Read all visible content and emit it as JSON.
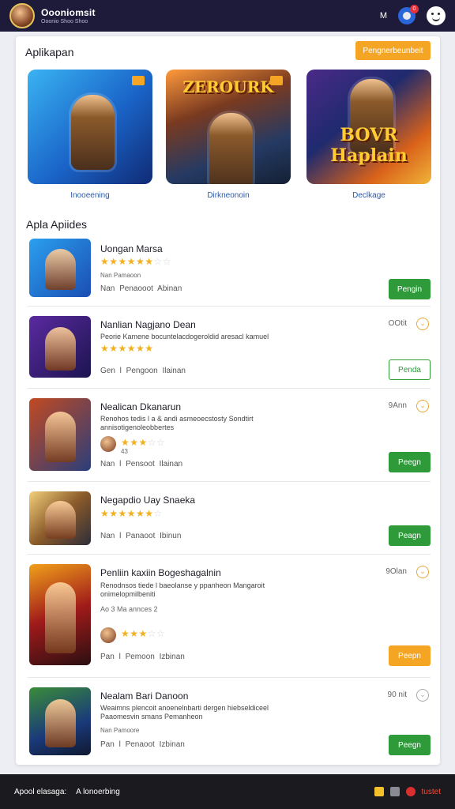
{
  "header": {
    "title": "Oooniomsit",
    "subtitle": "Ooonio Shoo Shoo",
    "right_text": "M",
    "notif_count": "0"
  },
  "featured": {
    "section_title": "Aplikapan",
    "cta_label": "Pengnerbeunbeit",
    "items": [
      {
        "label": "Inooeening",
        "logo": ""
      },
      {
        "label": "Dirkneonoin",
        "logo": "ZEROURK"
      },
      {
        "label": "Declkage",
        "logo": "BOVR Haplain"
      }
    ]
  },
  "list": {
    "section_title": "Apla Apiides",
    "items": [
      {
        "name": "Uongan Marsa",
        "desc": "",
        "rating": 4.5,
        "extra": "Nan Pamaoon",
        "meta": "Nan Penaooot   Abinan",
        "number": "",
        "button": "Pengin",
        "button_style": "green"
      },
      {
        "name": "Nanlian Nagjano Dean",
        "desc": "Peorie Kamene bocuntelacdogeroldid aresacl kamuel",
        "rating": 5,
        "extra": "",
        "meta": "Gen l Pengoon   Ilainan",
        "number": "OOtit",
        "button": "Penda",
        "button_style": "outline"
      },
      {
        "name": "Nealican Dkanarun",
        "desc": "Renohos tedis  l a & andi asmeoecstosty Sondtirt annisotigenoleobbertes",
        "rating": 3,
        "extra": "43",
        "meta": "Nan l Pensoot   Ilainan",
        "number": "9Ann",
        "button": "Peegn",
        "button_style": "green"
      },
      {
        "name": "Negapdio Uay Snaeka",
        "desc": "",
        "rating": 5,
        "extra": "",
        "meta": "Nan l Panaoot   Ibinun",
        "number": "",
        "button": "Peagn",
        "button_style": "green"
      },
      {
        "name": "Penliin kaxiin Bogeshagalnin",
        "desc": "Renodnsos tiede  l baeolanse y ppanheon Mangaroit onimelopmilbeniti",
        "rating": 3,
        "extra": "Ao 3 Ma annces 2",
        "meta": "Pan l Pemoon   Izbinan",
        "number": "9Olan",
        "button": "Peepn",
        "button_style": "orange"
      },
      {
        "name": "Nealam Bari Danoon",
        "desc": "Weaimns plencoit anoenelnbarti dergen hiebseldiceel Paaomesvin smans Pemanheon",
        "rating": 0,
        "extra": "Nan Pamoore",
        "meta": "Pan l Penaoot   Izbinan",
        "number": "90 nit",
        "button": "Peegn",
        "button_style": "green"
      }
    ]
  },
  "footer": {
    "left_a": "Apool elasaga:",
    "left_b": "A lonoerbing",
    "right_text": "tustet"
  }
}
